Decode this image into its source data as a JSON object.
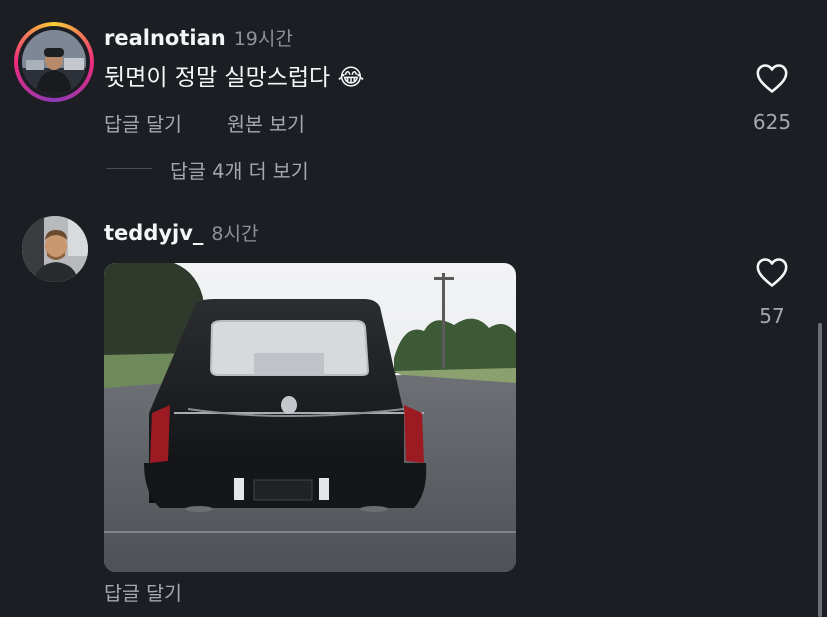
{
  "comments": [
    {
      "username": "realnotian",
      "time": "19시간",
      "text": "뒷면이 정말 실망스럽다 😂",
      "reply_label": "답글 달기",
      "original_label": "원본 보기",
      "like_count": "625",
      "view_replies_label": "답글 4개 더 보기",
      "avatar_icon": "avatar-photo"
    },
    {
      "username": "teddyjv_",
      "time": "8시간",
      "image": "hearse-rear-photo",
      "reply_label": "답글 달기",
      "like_count": "57",
      "avatar_icon": "avatar-photo"
    }
  ],
  "colors": {
    "background": "#1c1e23",
    "primary_text": "#f3f5f7",
    "secondary_text": "#a4a8ad"
  }
}
